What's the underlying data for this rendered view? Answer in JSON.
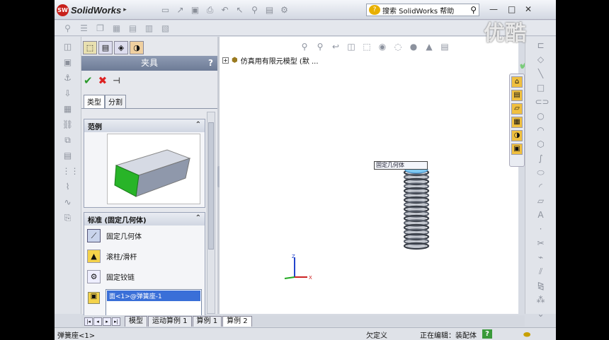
{
  "app": {
    "name": "SolidWorks",
    "logo_text": "SW"
  },
  "titlebar": {
    "search_placeholder": "搜索 SolidWorks 帮助",
    "win_min": "—",
    "win_restore": "□",
    "win_close": "✕"
  },
  "watermark": "优酷",
  "pm": {
    "title": "夹具",
    "help": "?",
    "ok_label": "✔",
    "cancel_label": "✖",
    "pin_label": "⊣",
    "tabs": [
      {
        "label": "类型",
        "active": true
      },
      {
        "label": "分割",
        "active": false
      }
    ],
    "example": {
      "heading": "范例"
    },
    "standard": {
      "heading": "标准 (固定几何体)",
      "options": [
        {
          "label": "固定几何体",
          "icon": "fixed-geometry-icon",
          "selected": true
        },
        {
          "label": "滚柱/滑杆",
          "icon": "roller-slider-icon",
          "selected": false
        },
        {
          "label": "固定铰链",
          "icon": "fixed-hinge-icon",
          "selected": false
        }
      ],
      "selection": "面<1>@弹簧座-1"
    }
  },
  "viewport": {
    "tree_text": "仿真用有限元模型  (默 ..."
  },
  "callout_text": "固定几何体",
  "bottom_tabs": [
    "模型",
    "运动算例 1",
    "算例 1",
    "算例 2"
  ],
  "bottom_active_tab": "算例 2",
  "statusbar": {
    "left": "弹簧座<1>",
    "underdefined": "欠定义",
    "editing": "正在编辑：装配体",
    "help": "?"
  },
  "colors": {
    "pm_title_bg": "#7b88a3",
    "ok_green": "#2a9a2a",
    "cancel_red": "#d22222",
    "selection_blue": "#3a6fd8",
    "face_green": "#28b428"
  }
}
